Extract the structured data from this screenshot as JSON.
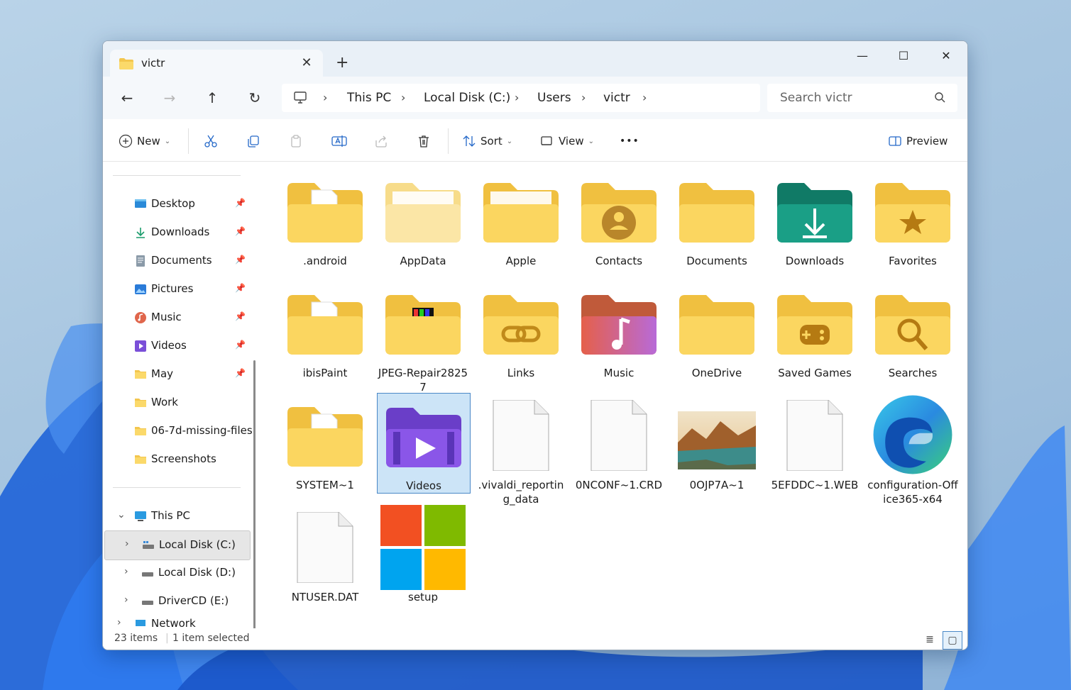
{
  "window": {
    "tab_title": "victr",
    "new_tab": "+",
    "minimize": "—",
    "maximize": "☐",
    "close": "✕"
  },
  "address": {
    "crumbs": [
      "This PC",
      "Local Disk (C:)",
      "Users",
      "victr"
    ],
    "search_placeholder": "Search victr"
  },
  "toolbar": {
    "new": "New",
    "sort": "Sort",
    "view": "View",
    "more": "•••",
    "preview": "Preview"
  },
  "sidebar": {
    "quick_access": [
      {
        "label": "Desktop",
        "pinned": true,
        "icon": "desktop-icon"
      },
      {
        "label": "Downloads",
        "pinned": true,
        "icon": "download-icon"
      },
      {
        "label": "Documents",
        "pinned": true,
        "icon": "documents-icon"
      },
      {
        "label": "Pictures",
        "pinned": true,
        "icon": "pictures-icon"
      },
      {
        "label": "Music",
        "pinned": true,
        "icon": "music-icon"
      },
      {
        "label": "Videos",
        "pinned": true,
        "icon": "videos-icon"
      },
      {
        "label": "May",
        "pinned": true,
        "icon": "folder-icon"
      },
      {
        "label": "Work",
        "pinned": false,
        "icon": "folder-icon"
      },
      {
        "label": "06-7d-missing-files",
        "pinned": false,
        "icon": "folder-icon"
      },
      {
        "label": "Screenshots",
        "pinned": false,
        "icon": "folder-icon"
      }
    ],
    "this_pc": "This PC",
    "drives": [
      "Local Disk (C:)",
      "Local Disk (D:)",
      "DriverCD (E:)"
    ],
    "network_partial": "Network"
  },
  "items": [
    {
      "name": ".android",
      "type": "folder-doc"
    },
    {
      "name": "AppData",
      "type": "folder-light"
    },
    {
      "name": "Apple",
      "type": "folder-paper"
    },
    {
      "name": "Contacts",
      "type": "folder-contacts"
    },
    {
      "name": "Documents",
      "type": "folder"
    },
    {
      "name": "Downloads",
      "type": "folder-downloads"
    },
    {
      "name": "Favorites",
      "type": "folder-star"
    },
    {
      "name": "ibisPaint",
      "type": "folder-doc"
    },
    {
      "name": "JPEG-Repair28257",
      "type": "folder-img"
    },
    {
      "name": "Links",
      "type": "folder-links"
    },
    {
      "name": "Music",
      "type": "folder-music"
    },
    {
      "name": "OneDrive",
      "type": "folder"
    },
    {
      "name": "Saved Games",
      "type": "folder-games"
    },
    {
      "name": "Searches",
      "type": "folder-search"
    },
    {
      "name": "SYSTEM~1",
      "type": "folder-doc"
    },
    {
      "name": "Videos",
      "type": "folder-videos"
    },
    {
      "name": ".vivaldi_reporting_data",
      "type": "file"
    },
    {
      "name": "0NCONF~1.CRD",
      "type": "file"
    },
    {
      "name": "0OJP7A~1",
      "type": "photo"
    },
    {
      "name": "5EFDDC~1.WEB",
      "type": "file"
    },
    {
      "name": "configuration-Office365-x64",
      "type": "edge"
    },
    {
      "name": "NTUSER.DAT",
      "type": "file"
    },
    {
      "name": "setup",
      "type": "windows"
    }
  ],
  "selected_index": 15,
  "status": {
    "count": "23 items",
    "selection": "1 item selected"
  }
}
